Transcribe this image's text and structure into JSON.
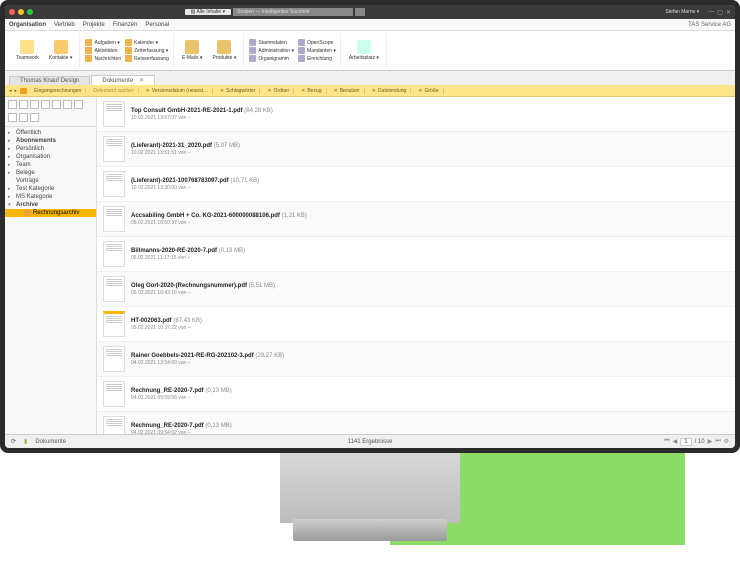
{
  "titlebar": {
    "filter_label": "Alle Inhalte",
    "search_placeholder": "Scopen — Intelligentes Suchfeld",
    "user": "Stefan Marne ▾"
  },
  "menubar": {
    "items": [
      "Organisation",
      "Vertrieb",
      "Projekte",
      "Finanzen",
      "Personal"
    ],
    "active": 0,
    "company": "TAS Service AG"
  },
  "ribbon": {
    "g0": {
      "teamwork": "Teamwork",
      "kontakte": "Kontakte ▾"
    },
    "g1": {
      "aufgaben": "Aufgaben ▾",
      "aktivitaeten": "Aktivitäten",
      "nachrichten": "Nachrichten",
      "kalender": "Kalender ▾",
      "zeiterfassung": "Zeiterfassung ▾",
      "reiseerfassung": "Reiseerfassung"
    },
    "g2": {
      "emails": "E-Mails ▾",
      "produkte": "Produkte ▾"
    },
    "g3": {
      "stammdaten": "Stammdaten",
      "administration": "Administration ▾",
      "organigramm": "Organigramm",
      "openscope": "OpenScope",
      "mandanten": "Mandanten ▾",
      "einrichtung": "Einrichtung"
    },
    "g4": {
      "arbeitsplatz": "Arbeitsplatz ▾"
    }
  },
  "tabs": [
    {
      "label": "Thomas Knauf Design"
    },
    {
      "label": "Dokumente",
      "active": true
    }
  ],
  "filters": {
    "eingang": "Eingangsrechnungen",
    "such": "Dokument suchen",
    "version": "Versionsdatum (neuest…",
    "cols": [
      "Schlagwörter",
      "Ordner",
      "Bezug",
      "Benutzer",
      "Dateiendung",
      "Größe"
    ]
  },
  "tree": [
    {
      "label": "Öffentlich",
      "arrow": "▸"
    },
    {
      "label": "Abonnements",
      "arrow": "▸",
      "bold": true
    },
    {
      "label": "Persönlich",
      "arrow": "▸"
    },
    {
      "label": "Organisation",
      "arrow": "▸"
    },
    {
      "label": "Team",
      "arrow": "▸"
    },
    {
      "label": "Belege",
      "arrow": "▸"
    },
    {
      "label": "Vorträge",
      "arrow": ""
    },
    {
      "label": "Test Kategorie",
      "arrow": "▸"
    },
    {
      "label": "MS Kategorie",
      "arrow": "▸"
    },
    {
      "label": "Archive",
      "arrow": "▾",
      "bold": true
    },
    {
      "label": "Rechnungsarchiv",
      "arrow": "",
      "selected": true,
      "indent": true
    }
  ],
  "documents": [
    {
      "name": "Top Consult GmbH-2021-RE-2021-1.pdf",
      "size": "(84,28 KB)",
      "meta": "10.02.2021 13:57:07 von –"
    },
    {
      "name": "(Lieferant)-2021-31_2020.pdf",
      "size": "(5,07 MB)",
      "meta": "10.02.2021 13:51:51 von –"
    },
    {
      "name": "(Lieferant)-2021-100768783097.pdf",
      "size": "(10,71 KB)",
      "meta": "10.02.2021 13:30:00 von –"
    },
    {
      "name": "Accsabiling GmbH + Co. KG-2021-600000088106.pdf",
      "size": "(1,21 KB)",
      "meta": "05.02.2021 16:50:37 von –"
    },
    {
      "name": "Billmanns-2020-RE-2020-7.pdf",
      "size": "(0,13 MB)",
      "meta": "05.02.2021 11:17:15 von –"
    },
    {
      "name": "Oleg Gorl-2020-(Rechnungsnummer).pdf",
      "size": "(5,51 MB)",
      "meta": "05.02.2021 10:43:16 von –"
    },
    {
      "name": "HT-002063.pdf",
      "size": "(87,43 KB)",
      "meta": "05.02.2021 10:37:22 von –",
      "yel": true
    },
    {
      "name": "Rainer Goebbels-2021-RE-RG-202102-3.pdf",
      "size": "(29,27 KB)",
      "meta": "04.02.2021 13:54:00 von –"
    },
    {
      "name": "Rechnung_RE-2020-7.pdf",
      "size": "(0,13 MB)",
      "meta": "04.02.2021 09:59:56 von –"
    },
    {
      "name": "Rechnung_RE-2020-7.pdf",
      "size": "(0,13 MB)",
      "meta": "04.02.2021 09:54:02 von –"
    }
  ],
  "status": {
    "breadcrumb": "Dokumente",
    "results": "1141 Ergebnisse",
    "page": "1",
    "pages": "/ 10"
  }
}
